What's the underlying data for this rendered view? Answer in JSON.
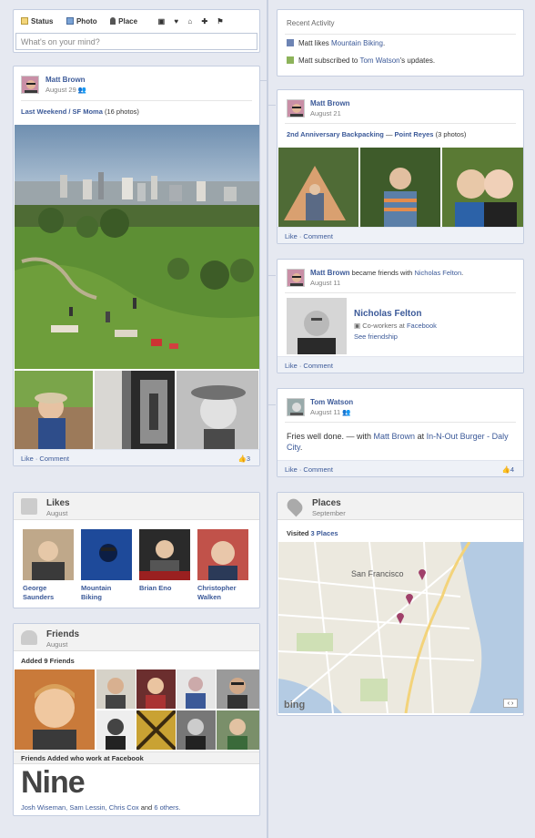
{
  "composer": {
    "tabs": [
      "Status",
      "Photo",
      "Place"
    ],
    "placeholder": "What's on your mind?"
  },
  "recent_activity": {
    "title": "Recent Activity",
    "items": [
      {
        "pre": "Matt likes ",
        "link": "Mountain Biking",
        "post": "."
      },
      {
        "pre": "Matt subscribed to ",
        "link": "Tom Watson",
        "post": "'s updates."
      }
    ]
  },
  "post1": {
    "author": "Matt Brown",
    "date": "August 29",
    "album_link": "Last Weekend / SF Moma",
    "album_count": "(16 photos)",
    "footer": "Like · Comment",
    "likes": "3"
  },
  "post2": {
    "author": "Matt Brown",
    "date": "August 21",
    "album_link": "2nd Anniversary Backpacking",
    "place_link": "Point Reyes",
    "album_count": "(3 photos)",
    "footer": "Like · Comment"
  },
  "post3": {
    "author": "Matt Brown",
    "verb": " became friends with ",
    "friend": "Nicholas Felton",
    "date": "August 11",
    "friend_title": "Nicholas Felton",
    "friend_work": "Co-workers at ",
    "friend_work_link": "Facebook",
    "see_friendship": "See friendship",
    "footer": "Like · Comment"
  },
  "post4": {
    "author": "Tom Watson",
    "date": "August 11",
    "text_pre": "Fries well done. — with ",
    "with_link": "Matt Brown",
    "at": " at ",
    "place_link": "In-N-Out Burger - Daly City",
    "text_post": ".",
    "footer": "Like · Comment",
    "likes": "4"
  },
  "likes_box": {
    "title": "Likes",
    "date": "August",
    "items": [
      "George Saunders",
      "Mountain Biking",
      "Brian Eno",
      "Christopher Walken"
    ]
  },
  "places_box": {
    "title": "Places",
    "date": "September",
    "visited_pre": "Visited ",
    "visited_link": "3 Places",
    "map_brand": "bing",
    "map_city": "San Francisco"
  },
  "friends_box": {
    "title": "Friends",
    "date": "August",
    "added": "Added 9 Friends",
    "work_label": "Friends Added who work at Facebook",
    "big_number": "Nine",
    "names_pre": "Josh Wiseman, Sam Lessin, Chris Cox",
    "names_and": " and ",
    "names_more": "6 others."
  }
}
